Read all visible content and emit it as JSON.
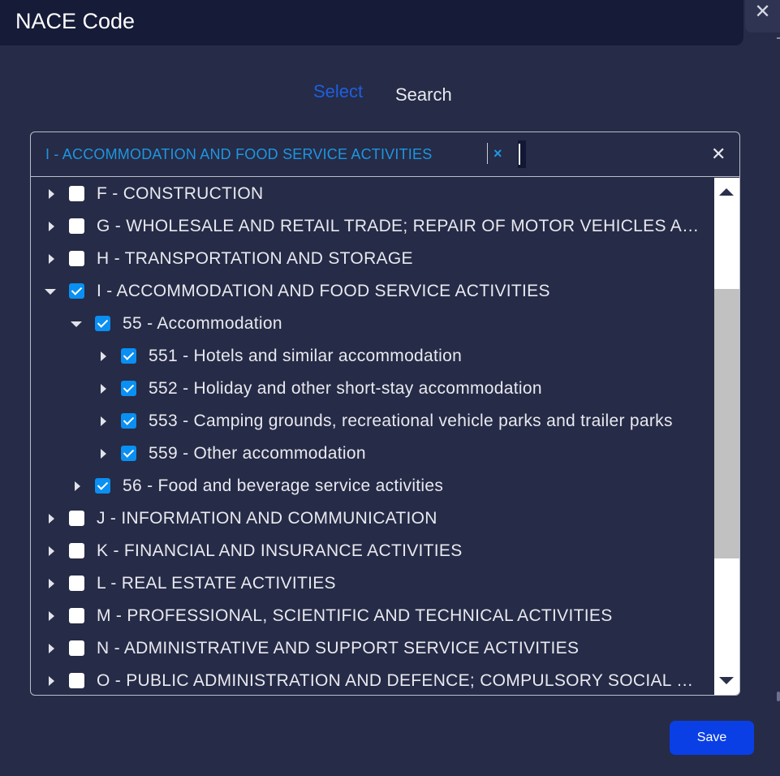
{
  "dialog": {
    "title": "NACE Code",
    "close_icon": "close-icon",
    "close_glyph": "✕"
  },
  "tabs": [
    {
      "label": "Select",
      "active": true
    },
    {
      "label": "Search",
      "active": false
    }
  ],
  "selection": {
    "chip_label": "I - ACCOMMODATION AND FOOD SERVICE ACTIVITIES",
    "chip_remove_glyph": "×",
    "clear_all_glyph": "✕"
  },
  "tree": [
    {
      "label": "F - CONSTRUCTION",
      "level": 0,
      "expanded": false,
      "checked": false
    },
    {
      "label": "G - WHOLESALE AND RETAIL TRADE; REPAIR OF MOTOR VEHICLES AND MOTORCYCLES",
      "level": 0,
      "expanded": false,
      "checked": false
    },
    {
      "label": "H - TRANSPORTATION AND STORAGE",
      "level": 0,
      "expanded": false,
      "checked": false
    },
    {
      "label": "I - ACCOMMODATION AND FOOD SERVICE ACTIVITIES",
      "level": 0,
      "expanded": true,
      "checked": true
    },
    {
      "label": "55 - Accommodation",
      "level": 1,
      "expanded": true,
      "checked": true
    },
    {
      "label": "551 - Hotels and similar accommodation",
      "level": 2,
      "expanded": false,
      "checked": true
    },
    {
      "label": "552 - Holiday and other short-stay accommodation",
      "level": 2,
      "expanded": false,
      "checked": true
    },
    {
      "label": "553 - Camping grounds, recreational vehicle parks and trailer parks",
      "level": 2,
      "expanded": false,
      "checked": true
    },
    {
      "label": "559 - Other accommodation",
      "level": 2,
      "expanded": false,
      "checked": true
    },
    {
      "label": "56 - Food and beverage service activities",
      "level": 1,
      "expanded": false,
      "checked": true
    },
    {
      "label": "J - INFORMATION AND COMMUNICATION",
      "level": 0,
      "expanded": false,
      "checked": false
    },
    {
      "label": "K - FINANCIAL AND INSURANCE ACTIVITIES",
      "level": 0,
      "expanded": false,
      "checked": false
    },
    {
      "label": "L - REAL ESTATE ACTIVITIES",
      "level": 0,
      "expanded": false,
      "checked": false
    },
    {
      "label": "M - PROFESSIONAL, SCIENTIFIC AND TECHNICAL ACTIVITIES",
      "level": 0,
      "expanded": false,
      "checked": false
    },
    {
      "label": "N - ADMINISTRATIVE AND SUPPORT SERVICE ACTIVITIES",
      "level": 0,
      "expanded": false,
      "checked": false
    },
    {
      "label": "O - PUBLIC ADMINISTRATION AND DEFENCE; COMPULSORY SOCIAL SECURITY",
      "level": 0,
      "expanded": false,
      "checked": false
    }
  ],
  "footer": {
    "save_label": "Save"
  },
  "colors": {
    "background": "#262b47",
    "header": "#161b38",
    "accent": "#1e5fe0",
    "checkbox_checked": "#0a8ff2",
    "save_button": "#0a3fe6"
  }
}
